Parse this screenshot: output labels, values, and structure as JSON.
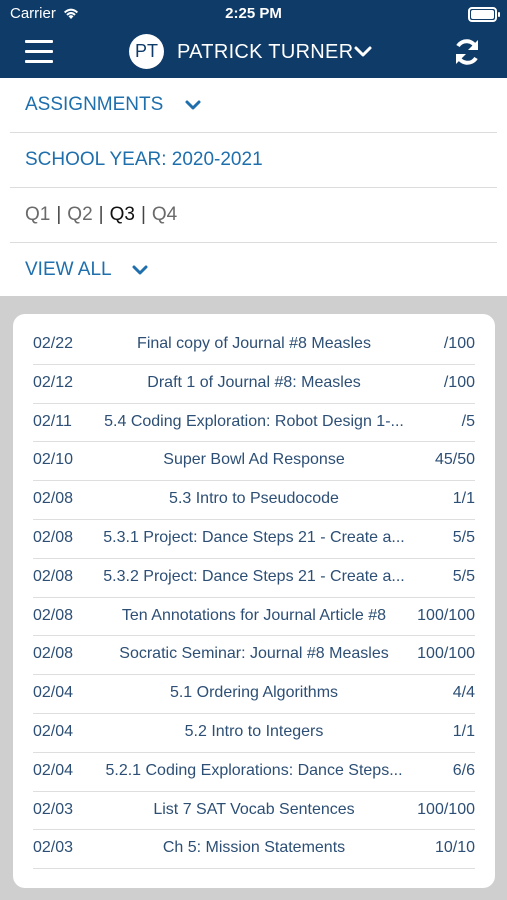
{
  "status_bar": {
    "carrier": "Carrier",
    "time": "2:25 PM"
  },
  "header": {
    "avatar_initials": "PT",
    "student_name": "PATRICK TURNER"
  },
  "menu": {
    "assignments": "ASSIGNMENTS",
    "school_year": "SCHOOL YEAR: 2020-2021",
    "quarters": [
      {
        "label": "Q1",
        "active": false
      },
      {
        "label": "Q2",
        "active": false
      },
      {
        "label": "Q3",
        "active": true
      },
      {
        "label": "Q4",
        "active": false
      }
    ],
    "view_all": "VIEW ALL"
  },
  "assignments": [
    {
      "date": "02/22",
      "title": "Final copy of Journal #8 Measles",
      "score": "/100"
    },
    {
      "date": "02/12",
      "title": "Draft 1 of Journal #8: Measles",
      "score": "/100"
    },
    {
      "date": "02/11",
      "title": "5.4 Coding Exploration: Robot Design 1-...",
      "score": "/5"
    },
    {
      "date": "02/10",
      "title": "Super Bowl Ad Response",
      "score": "45/50"
    },
    {
      "date": "02/08",
      "title": "5.3 Intro to Pseudocode",
      "score": "1/1"
    },
    {
      "date": "02/08",
      "title": "5.3.1 Project: Dance Steps 21 - Create a...",
      "score": "5/5"
    },
    {
      "date": "02/08",
      "title": "5.3.2 Project: Dance Steps 21 - Create a...",
      "score": "5/5"
    },
    {
      "date": "02/08",
      "title": "Ten Annotations for Journal Article #8",
      "score": "100/100"
    },
    {
      "date": "02/08",
      "title": "Socratic Seminar: Journal #8 Measles",
      "score": "100/100"
    },
    {
      "date": "02/04",
      "title": "5.1 Ordering Algorithms",
      "score": "4/4"
    },
    {
      "date": "02/04",
      "title": "5.2 Intro to Integers",
      "score": "1/1"
    },
    {
      "date": "02/04",
      "title": "5.2.1 Coding Explorations: Dance Steps...",
      "score": "6/6"
    },
    {
      "date": "02/03",
      "title": "List 7 SAT Vocab Sentences",
      "score": "100/100"
    },
    {
      "date": "02/03",
      "title": "Ch 5: Mission Statements",
      "score": "10/10"
    }
  ],
  "colors": {
    "header_bg": "#0f3b68",
    "link_blue": "#1f6fad",
    "row_text": "#2d4f75",
    "page_gray": "#cfcfcf"
  }
}
